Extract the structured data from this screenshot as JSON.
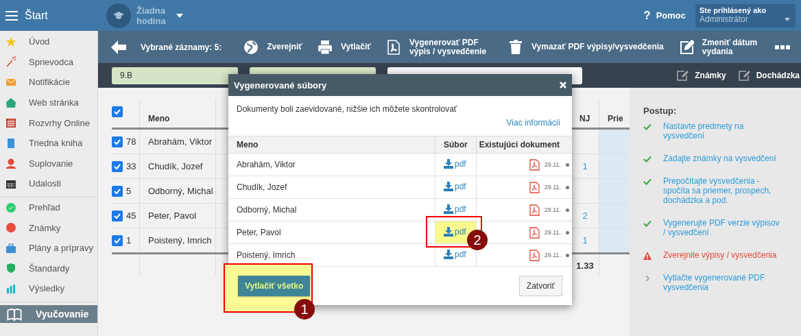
{
  "topbar": {
    "menu_label": "Štart",
    "lesson": "Žiadna hodina",
    "help_icon": "?",
    "help": "Pomoc",
    "user_caption": "Ste prihlásený ako",
    "user": "Administrátor"
  },
  "sidebar": {
    "groups": [
      [
        {
          "label": "Úvod",
          "selected": false
        },
        {
          "label": "Sprievodca",
          "selected": false
        },
        {
          "label": "Notifikácie",
          "selected": false
        },
        {
          "label": "Web stránka",
          "selected": false
        },
        {
          "label": "Rozvrhy Online",
          "selected": false
        },
        {
          "label": "Triedna kniha",
          "selected": false
        },
        {
          "label": "Suplovanie",
          "selected": false
        },
        {
          "label": "Udalosti",
          "selected": false
        }
      ],
      [
        {
          "label": "Prehľad",
          "selected": false
        },
        {
          "label": "Známky",
          "selected": false
        },
        {
          "label": "Plány a prípravy",
          "selected": false
        },
        {
          "label": "Štandardy",
          "selected": false
        },
        {
          "label": "Výsledky",
          "selected": false
        }
      ],
      [
        {
          "label": "Vyučovanie",
          "selected": true
        }
      ]
    ]
  },
  "toolbar": {
    "selected_count": "Vybrané záznamy: 5:",
    "actions": [
      {
        "label": "Zverejniť"
      },
      {
        "label": "Vytlačiť"
      },
      {
        "label": "Vygenerovať PDF výpis / vysvedčenie"
      },
      {
        "label": "Vymazať PDF výpisy/vysvedčenia"
      },
      {
        "label": "Zmeniť dátum vydania"
      }
    ]
  },
  "filters": {
    "class": "9.B",
    "links": [
      "Známky",
      "Dochádzka"
    ]
  },
  "table": {
    "all_checked": true,
    "columns": [
      "Meno",
      "NJ",
      "Prie"
    ],
    "rows": [
      {
        "checked": true,
        "number": "78",
        "name": "Abrahám, Viktor"
      },
      {
        "checked": true,
        "number": "33",
        "name": "Chudík, Jozef",
        "nj": "1"
      },
      {
        "checked": true,
        "number": "5",
        "name": "Odborný, Michal"
      },
      {
        "checked": true,
        "number": "45",
        "name": "Peter, Pavol",
        "nj": "2"
      },
      {
        "checked": true,
        "number": "1",
        "name": "Poistený, Imrich",
        "nj": "1"
      }
    ],
    "footer": {
      "nj": "1.33"
    }
  },
  "steps": {
    "title": "Postup:",
    "items": [
      {
        "label": "Nastavte predmety na vysvedčení",
        "kind": "done"
      },
      {
        "label": "Zadajte známky na vysvedčení",
        "kind": "done"
      },
      {
        "label": "Prepočítajte vysvedčenia - spočíta sa priemer, prospech, dochádzka a pod.",
        "kind": "done"
      },
      {
        "label": "Vygenerujte PDF verzie výpisov / vysvedčení",
        "kind": "done"
      },
      {
        "label": "Zverejnite výpisy / vysvedčenia",
        "kind": "warning"
      },
      {
        "label": "Vytlačte vygenerované PDF vysvedčenia",
        "kind": "pending"
      }
    ]
  },
  "dialog": {
    "title": "Vygenerované súbory",
    "message": "Dokumenty boli zaevidované, nižšie ich môžete skontrolovať",
    "link": "Viac informácií",
    "columns": [
      "Meno",
      "Súbor",
      "Existujúci dokument"
    ],
    "rows": [
      {
        "name": "Abrahám, Viktor",
        "file": "pdf",
        "date": "29.11."
      },
      {
        "name": "Chudík, Jozef",
        "file": "pdf",
        "date": "29.11."
      },
      {
        "name": "Odborný, Michal",
        "file": "pdf",
        "date": "29.11."
      },
      {
        "name": "Peter, Pavol",
        "file": "pdf",
        "date": "29.11.",
        "marker": "2"
      },
      {
        "name": "Poistený, Imrich",
        "file": "pdf",
        "date": "29.11."
      }
    ],
    "print_all": "Vytlačiť všetko",
    "print_marker": "1",
    "close": "Zatvoriť"
  }
}
